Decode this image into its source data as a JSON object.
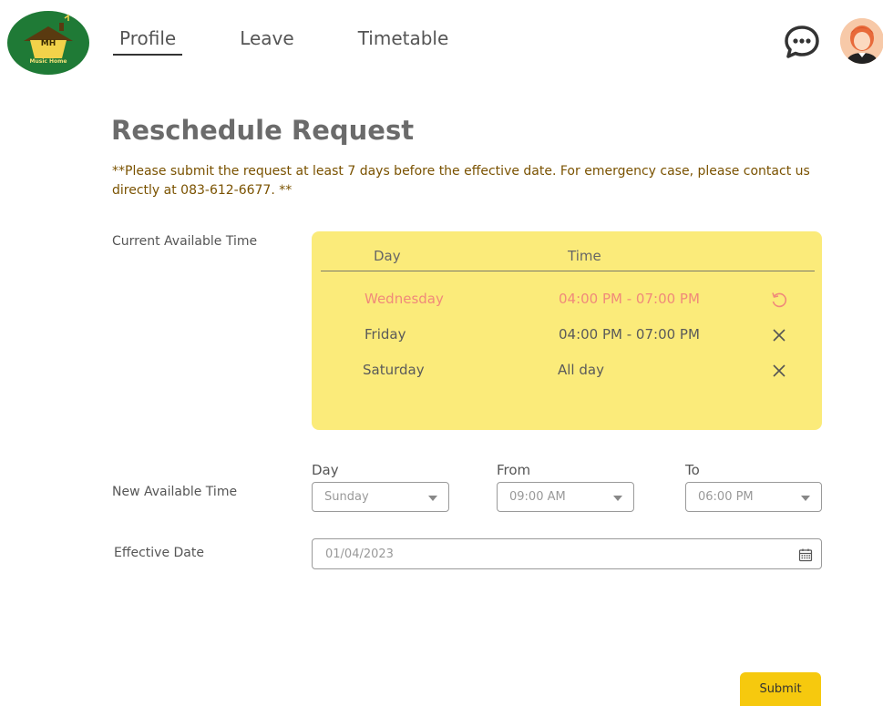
{
  "logo": {
    "initials": "MH",
    "text": "Music Home"
  },
  "nav": {
    "items": [
      {
        "label": "Profile",
        "active": true
      },
      {
        "label": "Leave",
        "active": false
      },
      {
        "label": "Timetable",
        "active": false
      }
    ]
  },
  "header_icons": {
    "chat": "chat-bubble-icon",
    "avatar": "user-avatar"
  },
  "page": {
    "title": "Reschedule Request",
    "notice": "**Please submit the request at least 7 days before the effective date. For emergency case, please contact us directly at 083-612-6677. **"
  },
  "current_time": {
    "label": "Current Available Time",
    "headers": {
      "day": "Day",
      "time": "Time"
    },
    "rows": [
      {
        "day": "Wednesday",
        "time": "04:00 PM - 07:00 PM",
        "action": "undo-icon",
        "highlight": true
      },
      {
        "day": "Friday",
        "time": "04:00 PM - 07:00 PM",
        "action": "close-icon",
        "highlight": false
      },
      {
        "day": "Saturday",
        "time": "All day",
        "action": "close-icon",
        "highlight": false
      }
    ]
  },
  "new_time": {
    "label": "New Available Time",
    "day": {
      "label": "Day",
      "value": "Sunday"
    },
    "from": {
      "label": "From",
      "value": "09:00 AM"
    },
    "to": {
      "label": "To",
      "value": "06:00 PM"
    }
  },
  "effective_date": {
    "label": "Effective Date",
    "value": "01/04/2023",
    "icon": "calendar-icon"
  },
  "submit_label": "Submit",
  "colors": {
    "accent": "#f6c90e",
    "panel": "#fbeb7a",
    "logo_bg": "#1f7a36",
    "notice": "#7a5200",
    "highlight": "#f08a7a"
  }
}
